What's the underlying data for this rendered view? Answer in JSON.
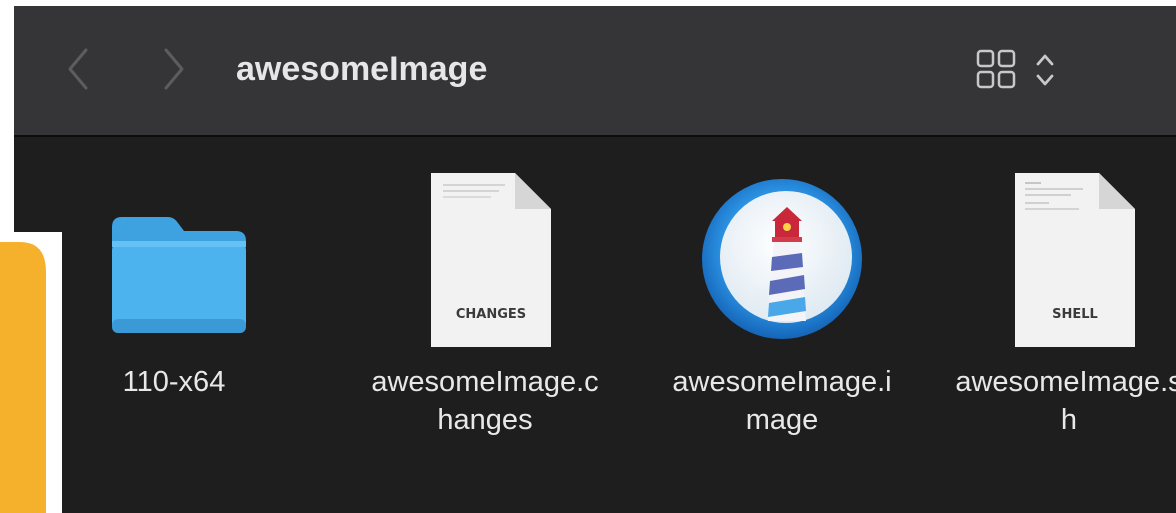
{
  "window": {
    "title": "awesomeImage"
  },
  "toolbar": {
    "back_icon": "chevron-left-icon",
    "forward_icon": "chevron-right-icon",
    "view_icon": "grid-view-icon",
    "sort_icon": "up-down-chevron-icon"
  },
  "files": [
    {
      "name_line1": "110-x64",
      "name_line2": "",
      "icon": "folder-icon",
      "color": "#4aaee8"
    },
    {
      "name_line1": "awesomeImage.c",
      "name_line2": "hanges",
      "icon": "document-icon",
      "tag": "CHANGES"
    },
    {
      "name_line1": "awesomeImage.i",
      "name_line2": "mage",
      "icon": "lighthouse-app-icon"
    },
    {
      "name_line1": "awesomeImage.s",
      "name_line2": "h",
      "icon": "document-icon",
      "tag": "SHELL"
    }
  ],
  "colors": {
    "toolbar_bg": "#353537",
    "content_bg": "#1e1e1e",
    "overlay_yellow": "#f6b12c"
  }
}
